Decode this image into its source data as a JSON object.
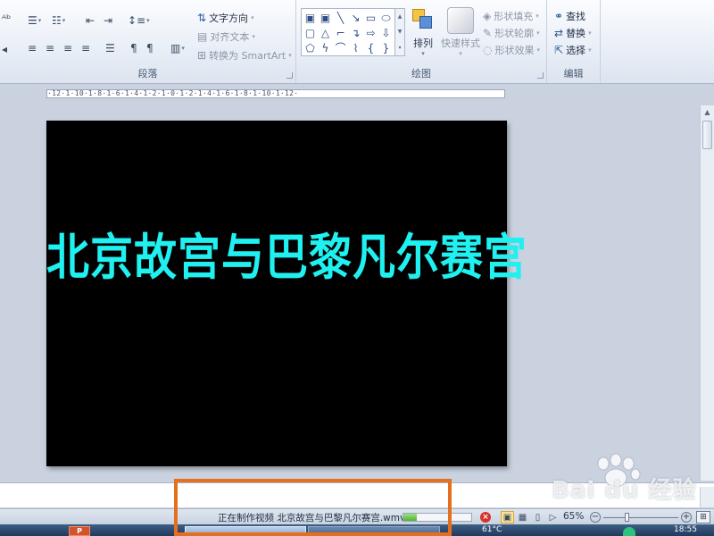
{
  "ribbon": {
    "paragraph": {
      "label": "段落",
      "text_direction": "文字方向",
      "align_text": "对齐文本",
      "convert_smartart": "转换为 SmartArt"
    },
    "drawing": {
      "label": "绘图",
      "arrange": "排列",
      "quick_styles": "快速样式",
      "shape_fill": "形状填充",
      "shape_outline": "形状轮廓",
      "shape_effects": "形状效果"
    },
    "editing": {
      "label": "编辑",
      "find": "查找",
      "replace": "替换",
      "select": "选择"
    }
  },
  "ruler": {
    "text": "·12·1·10·1·8·1·6·1·4·1·2·1·0·1·2·1·4·1·6·1·8·1·10·1·12·"
  },
  "slide": {
    "title": "北京故宫与巴黎凡尔赛宫",
    "background": "#000000",
    "title_color": "#20f0f0"
  },
  "status_bar": {
    "export_status": "正在制作视频 北京故宫与巴黎凡尔赛宫.wmv",
    "progress": 0.2,
    "zoom_label": "65%"
  },
  "taskbar": {
    "temperature": "61°C",
    "time": "18:55"
  },
  "watermark": {
    "text": "Bai du 经验"
  },
  "colors": {
    "highlight": "#e4701f",
    "progress": "#4eb33a",
    "cancel": "#d6332c"
  }
}
